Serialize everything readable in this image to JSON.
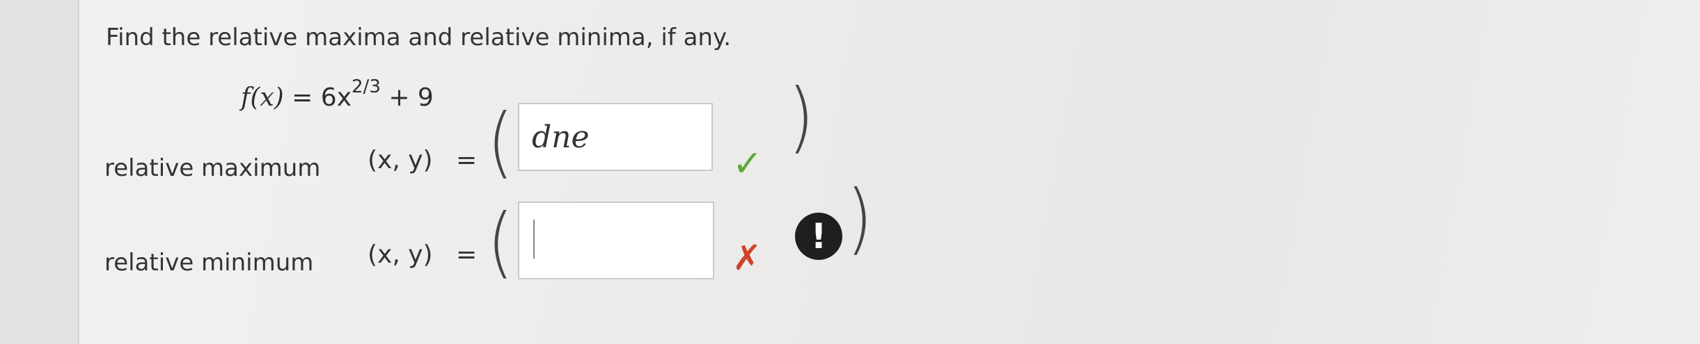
{
  "prompt": "Find the relative maxima and relative minima, if any.",
  "function": {
    "lhs": "f(x)",
    "equals": "=",
    "base": "6x",
    "exponent": "2/3",
    "rest": "+ 9"
  },
  "rows": [
    {
      "label": "relative maximum",
      "xy": "(x, y)",
      "equals": "=",
      "open": "(",
      "close": ")",
      "value": "dne",
      "status_icon": "checkmark-icon",
      "status_glyph": "✓"
    },
    {
      "label": "relative minimum",
      "xy": "(x, y)",
      "equals": "=",
      "open": "(",
      "close": ")",
      "value": "",
      "status_icon": "x-mark-icon",
      "status_glyph": "✗",
      "alert_glyph": "!"
    }
  ],
  "colors": {
    "correct": "#5fa83a",
    "incorrect": "#d0412c",
    "alert_bg": "#1f1f1f"
  }
}
